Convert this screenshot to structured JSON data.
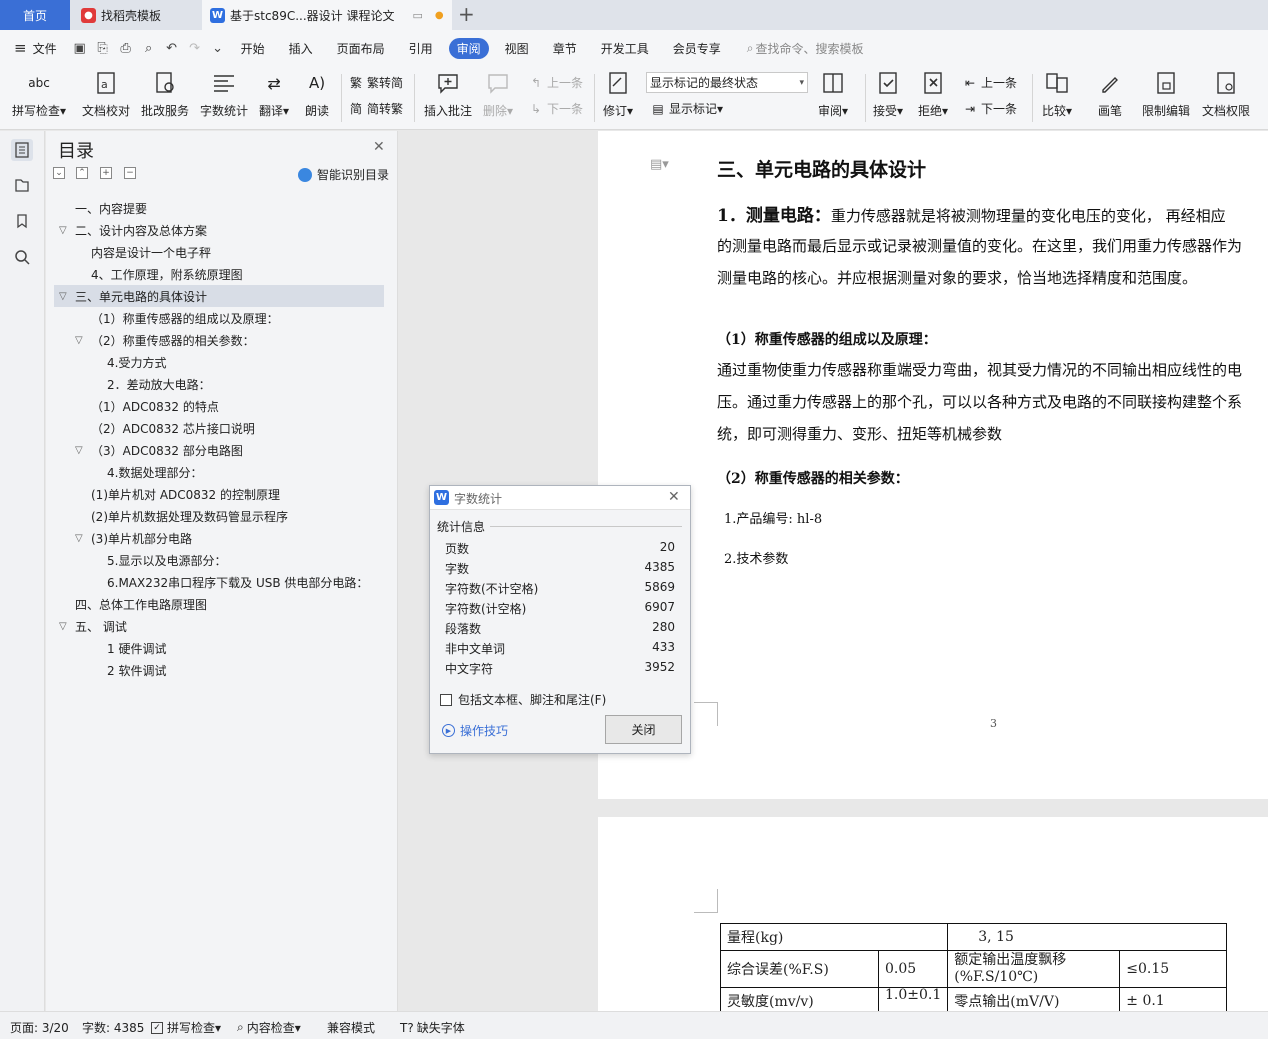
{
  "tabs": {
    "home": "首页",
    "t1": "找稻壳模板",
    "t2": "基于stc89C...器设计 课程论文"
  },
  "menu": {
    "file": "文件",
    "items": [
      "开始",
      "插入",
      "页面布局",
      "引用",
      "审阅",
      "视图",
      "章节",
      "开发工具",
      "会员专享"
    ],
    "search": "查找命令、搜索模板"
  },
  "ribbon": {
    "spell": "拼写检查",
    "proof": "文档校对",
    "batch": "批改服务",
    "count": "字数统计",
    "translate": "翻译",
    "read": "朗读",
    "t2s": "繁转简",
    "s2t": "简转繁",
    "add_comment": "插入批注",
    "delete": "删除",
    "prev": "上一条",
    "next": "下一条",
    "revise": "修订",
    "markup_select": "显示标记的最终状态",
    "show_markup": "显示标记",
    "review": "审阅",
    "accept": "接受",
    "reject": "拒绝",
    "prev2": "上一条",
    "next2": "下一条",
    "compare": "比较",
    "pen": "画笔",
    "restrict": "限制编辑",
    "rights": "文档权限"
  },
  "toc": {
    "title": "目录",
    "smart": "智能识别目录",
    "items": [
      "一、内容提要",
      "二、设计内容及总体方案",
      "内容是设计一个电子秤",
      "4、工作原理，附系统原理图",
      "三、单元电路的具体设计",
      "（1）称重传感器的组成以及原理：",
      "（2）称重传感器的相关参数：",
      "4.受力方式",
      "2．差动放大电路：",
      "（1）ADC0832 的特点",
      "（2）ADC0832 芯片接口说明",
      "（3）ADC0832 部分电路图",
      "4.数据处理部分：",
      "(1)单片机对 ADC0832  的控制原理",
      "(2)单片机数据处理及数码管显示程序",
      "(3)单片机部分电路",
      "5.显示以及电源部分：",
      "6.MAX232串口程序下载及 USB 供电部分电路：",
      "四、总体工作电路原理图",
      "五、   调试",
      "1  硬件调试",
      "2  软件调试"
    ]
  },
  "doc": {
    "heading": "三、单元电路的具体设计",
    "p1_bold": "1．测量电路：",
    "p1a": "重力传感器就是将被测物理量的变化电压的变化， 再经相应",
    "p1b": "的测量电路而最后显示或记录被测量值的变化。在这里，我们用重力传感器作为",
    "p1c": "测量电路的核心。并应根据测量对象的要求，恰当地选择精度和范围度。",
    "s1": "（1）称重传感器的组成以及原理：",
    "p2a": "通过重物使重力传感器称重端受力弯曲，视其受力情况的不同输出相应线性的电",
    "p2b": "压。通过重力传感器上的那个孔，可以以各种方式及电路的不同联接构建整个系",
    "p2c": "统，即可测得重力、变形、扭矩等机械参数",
    "s2": "（2）称重传感器的相关参数：",
    "item1": "1.产品编号: hl-8",
    "item2": "2.技术参数",
    "page_num": "3",
    "table": {
      "r1c1": "量程(kg)",
      "r1c2": "3,   15",
      "r2c1": "综合误差(%F.S)",
      "r2c2": "0.05",
      "r2c3": "额定输出温度飘移(%F.S/10℃)",
      "r2c4": "≤0.15",
      "r3c1": "灵敏度(mv/v)",
      "r3c2": "1.0±0.1",
      "r3c3": "零点输出(mV/V)",
      "r3c4": "± 0.1"
    }
  },
  "dialog": {
    "title": "字数统计",
    "section": "统计信息",
    "rows": [
      {
        "k": "页数",
        "v": "20"
      },
      {
        "k": "字数",
        "v": "4385"
      },
      {
        "k": "字符数(不计空格)",
        "v": "5869"
      },
      {
        "k": "字符数(计空格)",
        "v": "6907"
      },
      {
        "k": "段落数",
        "v": "280"
      },
      {
        "k": "非中文单词",
        "v": "433"
      },
      {
        "k": "中文字符",
        "v": "3952"
      }
    ],
    "checkbox": "包括文本框、脚注和尾注(F)",
    "tips": "操作技巧",
    "close": "关闭"
  },
  "status": {
    "page": "页面: 3/20",
    "words": "字数: 4385",
    "spell": "拼写检查",
    "content": "内容检查",
    "compat": "兼容模式",
    "font": "缺失字体"
  }
}
